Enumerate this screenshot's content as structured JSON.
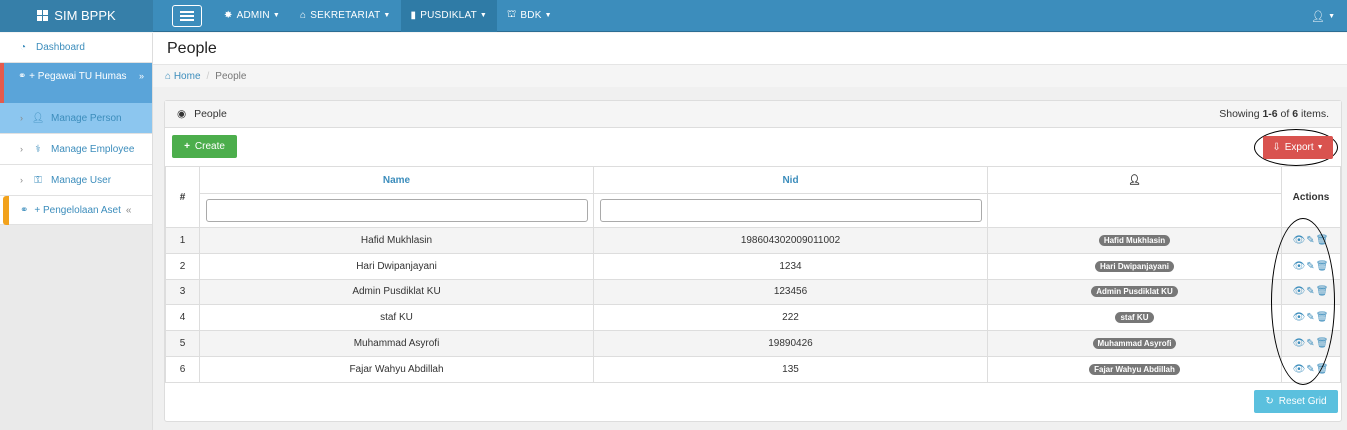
{
  "app": {
    "brand": "SIM BPPK",
    "brand_icon": "th-large-icon"
  },
  "navbar": {
    "menus": [
      {
        "label": "ADMIN",
        "icon": "gear-icon",
        "glyph": "✸"
      },
      {
        "label": "SEKRETARIAT",
        "icon": "home-icon",
        "glyph": "⌂"
      },
      {
        "label": "PUSDIKLAT",
        "icon": "building-icon",
        "glyph": "▮"
      },
      {
        "label": "BDK",
        "icon": "bank-icon",
        "glyph": "⛫"
      }
    ],
    "active_menu": "PUSDIKLAT"
  },
  "sidebar": {
    "dashboard": "Dashboard",
    "group1": {
      "label": "+ Pegawai TU Humas",
      "chevron": "»"
    },
    "sub_items": [
      {
        "label": "Manage Person",
        "active": true
      },
      {
        "label": "Manage Employee",
        "active": false
      },
      {
        "label": "Manage User",
        "active": false
      }
    ],
    "group2": {
      "label": "+ Pengelolaan Aset",
      "chevron": "«"
    }
  },
  "page": {
    "title": "People",
    "breadcrumb": {
      "home": "Home",
      "current": "People"
    }
  },
  "panel": {
    "title": "People",
    "summary_prefix": "Showing ",
    "summary_range": "1-6",
    "summary_mid": " of ",
    "summary_total": "6",
    "summary_suffix": " items.",
    "create_label": "Create",
    "export_label": "Export",
    "reset_label": "Reset Grid"
  },
  "table": {
    "headers": {
      "hash": "#",
      "name": "Name",
      "nid": "Nid",
      "actions": "Actions"
    },
    "rows": [
      {
        "no": "1",
        "name": "Hafid Mukhlasin",
        "nid": "198604302009011002",
        "user": "Hafid Mukhlasin"
      },
      {
        "no": "2",
        "name": "Hari Dwipanjayani",
        "nid": "1234",
        "user": "Hari Dwipanjayani"
      },
      {
        "no": "3",
        "name": "Admin Pusdiklat KU",
        "nid": "123456",
        "user": "Admin Pusdiklat KU"
      },
      {
        "no": "4",
        "name": "staf KU",
        "nid": "222",
        "user": "staf KU"
      },
      {
        "no": "5",
        "name": "Muhammad Asyrofi",
        "nid": "19890426",
        "user": "Muhammad Asyrofi"
      },
      {
        "no": "6",
        "name": "Fajar Wahyu Abdillah",
        "nid": "135",
        "user": "Fajar Wahyu Abdillah"
      }
    ]
  },
  "colors": {
    "navbar": "#3c8dbc",
    "create": "#4cae4c",
    "export": "#d9534f",
    "reset": "#5bc0de"
  }
}
